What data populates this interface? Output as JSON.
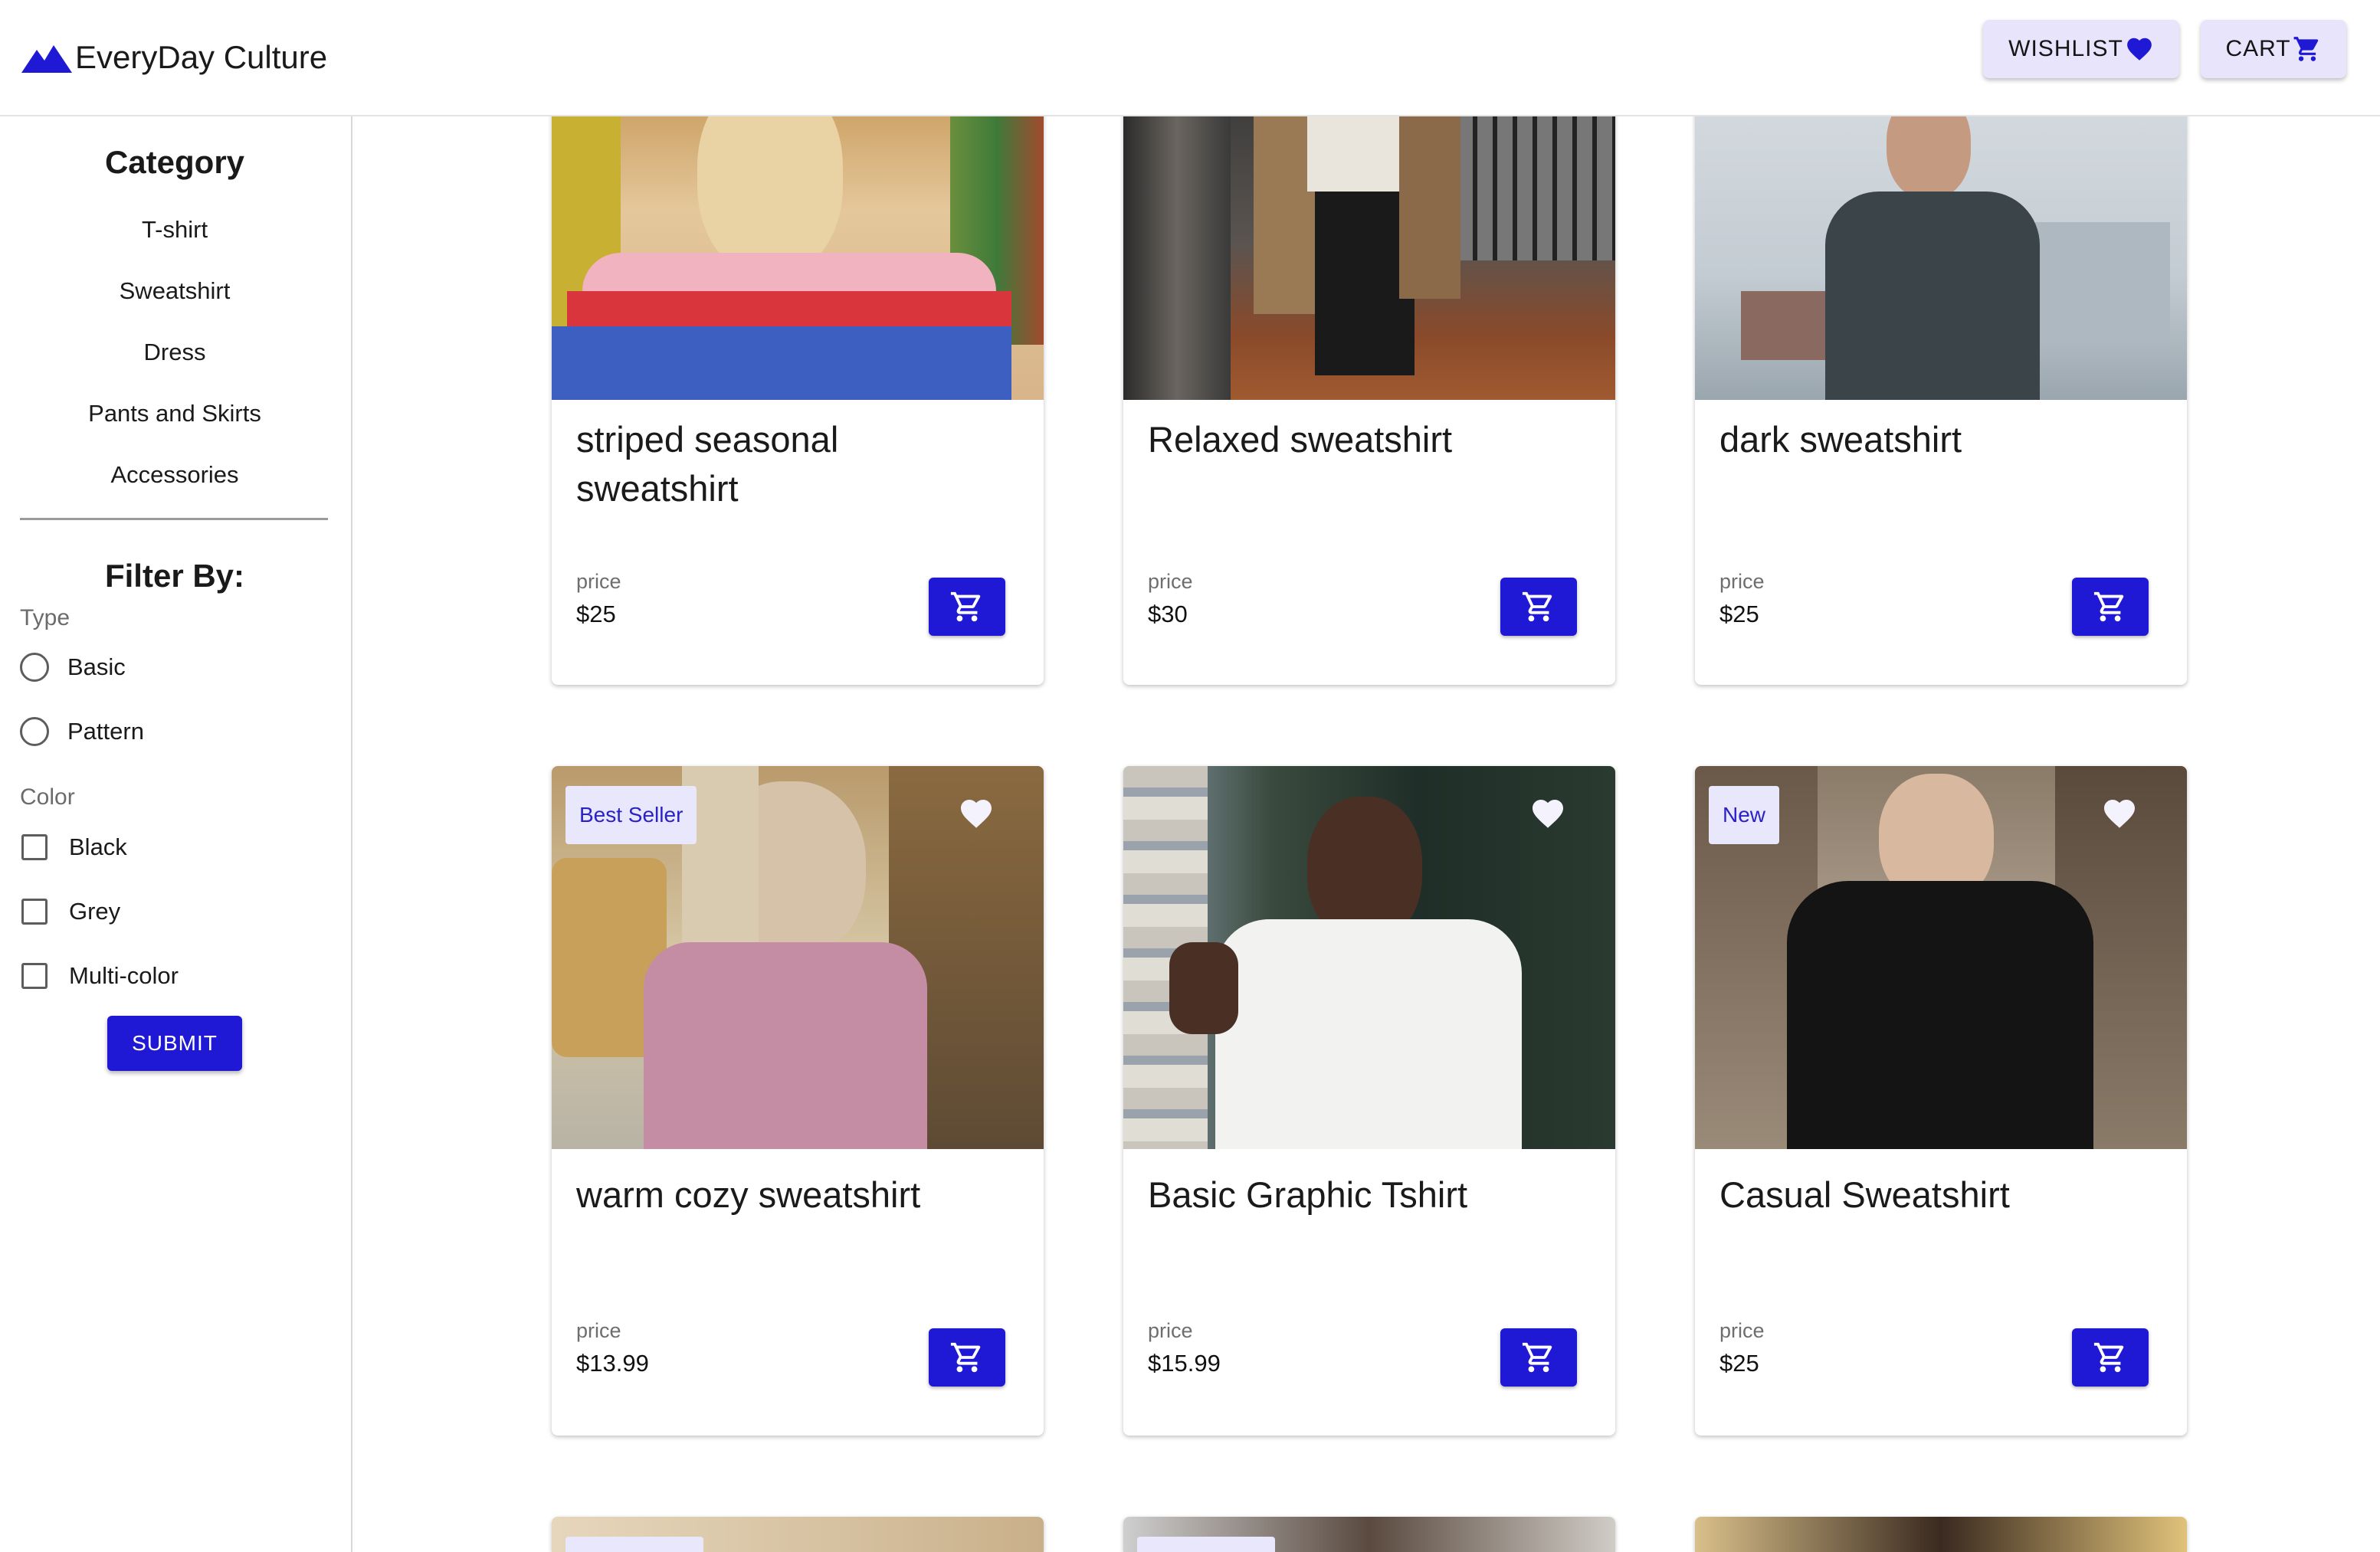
{
  "app": {
    "brand": "EveryDay Culture",
    "wishlist_label": "WISHLIST",
    "cart_label": "CART"
  },
  "sidebar": {
    "category_title": "Category",
    "categories": [
      "T-shirt",
      "Sweatshirt",
      "Dress",
      "Pants and Skirts",
      "Accessories"
    ],
    "filter_title": "Filter By:",
    "type_label": "Type",
    "type_options": [
      "Basic",
      "Pattern"
    ],
    "color_label": "Color",
    "color_options": [
      "Black",
      "Grey",
      "Multi-color"
    ],
    "submit_label": "SUBMIT"
  },
  "products": [
    {
      "title": "striped seasonal sweatshirt",
      "price_label": "price",
      "price": "$25",
      "badge": ""
    },
    {
      "title": "Relaxed sweatshirt",
      "price_label": "price",
      "price": "$30",
      "badge": ""
    },
    {
      "title": "dark sweatshirt",
      "price_label": "price",
      "price": "$25",
      "badge": ""
    },
    {
      "title": "warm cozy sweatshirt",
      "price_label": "price",
      "price": "$13.99",
      "badge": "Best Seller"
    },
    {
      "title": "Basic Graphic Tshirt",
      "price_label": "price",
      "price": "$15.99",
      "badge": ""
    },
    {
      "title": "Casual Sweatshirt",
      "price_label": "price",
      "price": "$25",
      "badge": "New"
    }
  ],
  "colors": {
    "accent": "#1f18d4",
    "badge_bg": "#e9e7fb",
    "header_button_bg": "#e7e4fb"
  },
  "icons": {
    "logo": "mountain-icon",
    "wishlist": "heart-icon",
    "cart": "cart-icon",
    "favorite": "heart-outline-icon"
  }
}
